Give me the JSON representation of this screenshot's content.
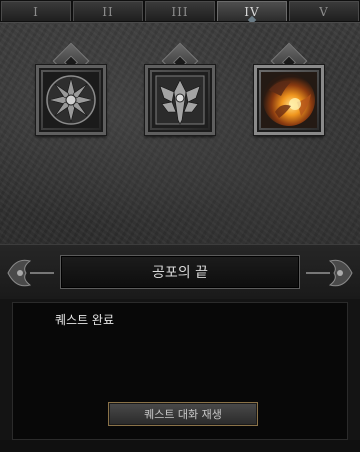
{
  "tabs": [
    {
      "label": "I",
      "active": false
    },
    {
      "label": "II",
      "active": false
    },
    {
      "label": "III",
      "active": false
    },
    {
      "label": "IV",
      "active": true
    },
    {
      "label": "V",
      "active": false
    }
  ],
  "quests": [
    {
      "icon": "ornate-flower-icon",
      "state": "completed"
    },
    {
      "icon": "winged-emblem-icon",
      "state": "completed"
    },
    {
      "icon": "fiery-demon-icon",
      "state": "selected"
    }
  ],
  "quest_title": "공포의 끝",
  "quest_status": "퀘스트 완료",
  "replay_button_label": "퀘스트 대화 재생",
  "colors": {
    "panel": "#333333",
    "dialog_bg": "#080808",
    "button_border": "#8a7248",
    "text": "#d9d9d9"
  }
}
